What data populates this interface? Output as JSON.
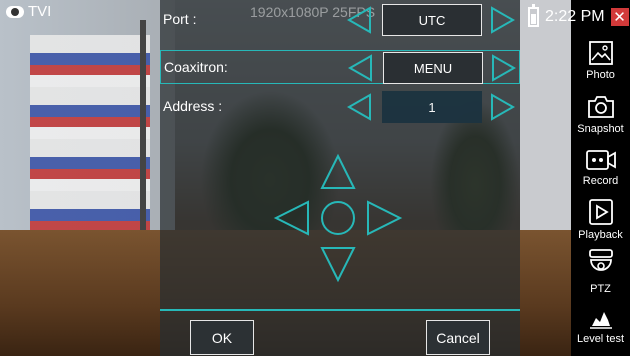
{
  "camera": {
    "channel": "TVI",
    "resolution": "1920x1080P 25FPS"
  },
  "settings": {
    "rows": [
      {
        "label": "Port :",
        "value": "UTC"
      },
      {
        "label": "Coaxitron:",
        "value": "MENU"
      },
      {
        "label": "Address :",
        "value": "1"
      }
    ]
  },
  "buttons": {
    "ok": "OK",
    "cancel": "Cancel"
  },
  "status": {
    "time": "2:22 PM",
    "close": "✕"
  },
  "tools": [
    {
      "label": "Photo",
      "icon": "photo-icon"
    },
    {
      "label": "Snapshot",
      "icon": "camera-icon"
    },
    {
      "label": "Record",
      "icon": "record-icon"
    },
    {
      "label": "Playback",
      "icon": "playback-icon"
    },
    {
      "label": "PTZ",
      "icon": "ptz-icon"
    },
    {
      "label": "Level test",
      "icon": "level-test-icon"
    }
  ],
  "colors": {
    "accent": "#27b8b8",
    "close": "#d23a3a"
  }
}
